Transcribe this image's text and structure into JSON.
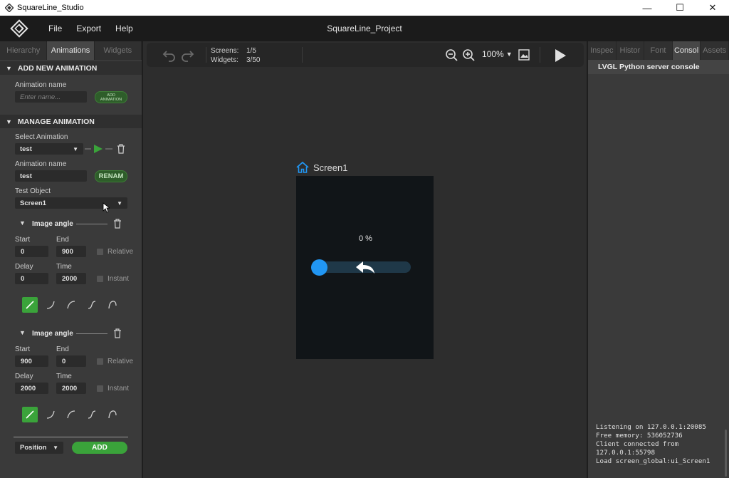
{
  "window": {
    "title": "SquareLine_Studio",
    "minimize": "—",
    "maximize": "☐",
    "close": "✕"
  },
  "menu": {
    "items": [
      "File",
      "Export",
      "Help"
    ],
    "project_title": "SquareLine_Project"
  },
  "left_tabs": [
    "Hierarchy",
    "Animations",
    "Widgets"
  ],
  "left_active_tab": "Animations",
  "add_animation": {
    "header": "ADD NEW ANIMATION",
    "name_label": "Animation name",
    "name_placeholder": "Enter name...",
    "add_button": "ADD ANIMATION"
  },
  "manage_animation": {
    "header": "MANAGE ANIMATION",
    "select_label": "Select Animation",
    "selected": "test",
    "name_label": "Animation name",
    "name_value": "test",
    "rename_button": "RENAM",
    "test_object_label": "Test Object",
    "test_object_value": "Screen1",
    "tracks": [
      {
        "title": "Image angle",
        "start_label": "Start",
        "start": "0",
        "end_label": "End",
        "end": "900",
        "relative_label": "Relative",
        "delay_label": "Delay",
        "delay": "0",
        "time_label": "Time",
        "time": "2000",
        "instant_label": "Instant"
      },
      {
        "title": "Image angle",
        "start_label": "Start",
        "start": "900",
        "end_label": "End",
        "end": "0",
        "relative_label": "Relative",
        "delay_label": "Delay",
        "delay": "2000",
        "time_label": "Time",
        "time": "2000",
        "instant_label": "Instant"
      }
    ],
    "property_select": "Position",
    "add_button": "ADD"
  },
  "toolbar": {
    "screens_label": "Screens:",
    "screens_value": "1/5",
    "widgets_label": "Widgets:",
    "widgets_value": "3/50",
    "zoom": "100%"
  },
  "canvas": {
    "screen_name": "Screen1",
    "percent_label": "0 %"
  },
  "right_tabs": [
    "Inspec",
    "Histor",
    "Font",
    "Consol",
    "Assets"
  ],
  "right_active_tab": "Consol",
  "console": {
    "title": "LVGL Python server console",
    "lines": [
      "Listening on 127.0.0.1:20085",
      "Free memory: 536052736",
      "Client connected from",
      "127.0.0.1:55798",
      "Load screen_global:ui_Screen1"
    ]
  },
  "colors": {
    "accent_green": "#3aa33a",
    "accent_blue": "#2196f3",
    "panel_bg": "#3a3a3a",
    "canvas_bg": "#2d2d2d"
  }
}
